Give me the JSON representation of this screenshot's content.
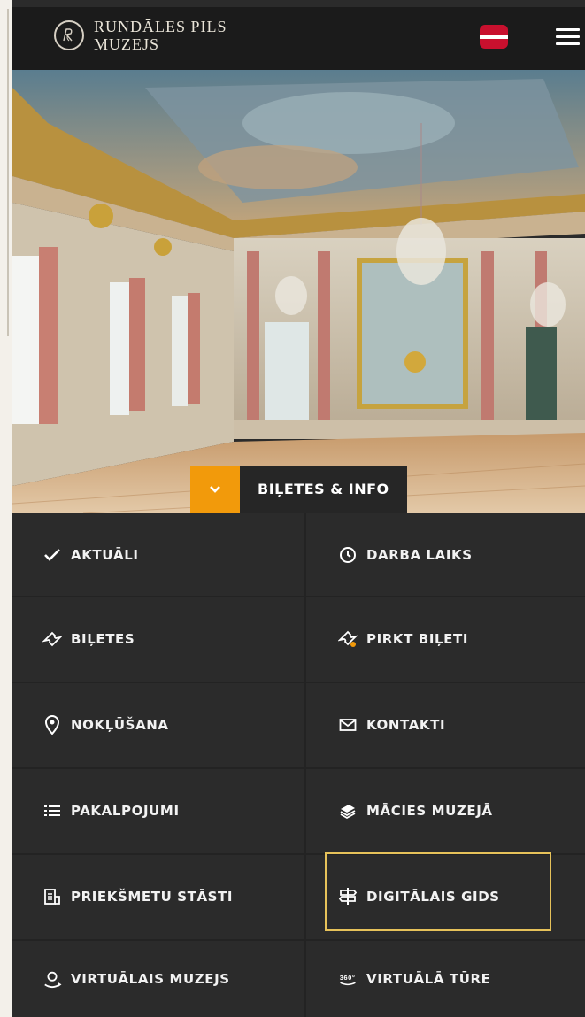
{
  "header": {
    "logo_line1": "RUNDĀLES PILS",
    "logo_line2": "MUZEJS",
    "flag_label": "",
    "menu_label": ""
  },
  "hero": {
    "cta_label": "BIĻETES & INFO"
  },
  "menu": {
    "items": [
      {
        "label": "AKTUĀLI",
        "icon": "check-icon"
      },
      {
        "label": "DARBA LAIKS",
        "icon": "clock-icon"
      },
      {
        "label": "BIĻETES",
        "icon": "ticket-icon"
      },
      {
        "label": "PIRKT BIĻETI",
        "icon": "buy-ticket-icon"
      },
      {
        "label": "NOKĻŪŠANA",
        "icon": "location-pin-icon"
      },
      {
        "label": "KONTAKTI",
        "icon": "envelope-icon"
      },
      {
        "label": "PAKALPOJUMI",
        "icon": "list-icon"
      },
      {
        "label": "MĀCIES MUZEJĀ",
        "icon": "books-icon"
      },
      {
        "label": "PRIEKŠMETU STĀSTI",
        "icon": "stories-icon"
      },
      {
        "label": "DIGITĀLAIS GIDS",
        "icon": "signpost-icon"
      },
      {
        "label": "VIRTUĀLAIS MUZEJS",
        "icon": "vr-person-icon"
      },
      {
        "label": "VIRTUĀLĀ TŪRE",
        "icon": "360-icon"
      }
    ]
  },
  "colors": {
    "accent": "#f29a0b",
    "header_bg": "#1b1b1b",
    "grid_bg": "#2b2b2b",
    "highlight": "#e6c25a",
    "flag_red": "#c8102e"
  }
}
